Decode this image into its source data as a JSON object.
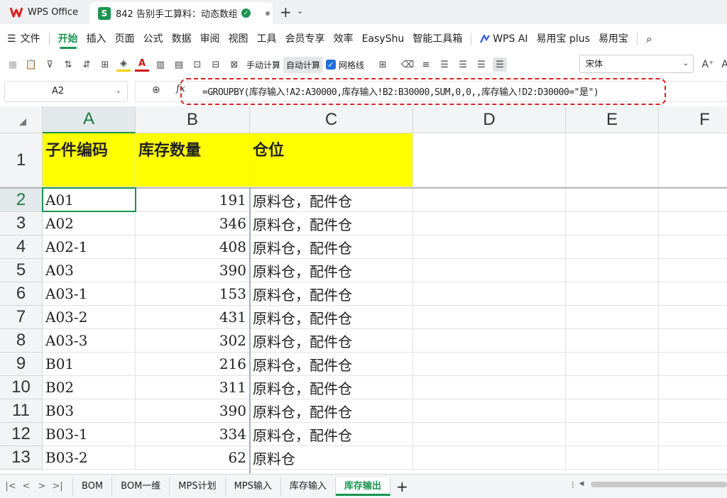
{
  "titlebar": {
    "app_name": "WPS Office",
    "doc_tab_title": "842 告别手工算料：动态数组"
  },
  "menu": {
    "items": [
      "文件",
      "开始",
      "插入",
      "页面",
      "公式",
      "数据",
      "审阅",
      "视图",
      "工具",
      "会员专享",
      "效率",
      "EasyShu",
      "智能工具箱",
      "WPS AI",
      "易用宝 plus",
      "易用宝"
    ],
    "active": "开始"
  },
  "toolbar": {
    "manual_calc": "手动计算",
    "auto_calc": "自动计算",
    "gridlines": "网格线",
    "font_name": "宋体"
  },
  "formula_bar": {
    "name_box": "A2",
    "formula": "=GROUPBY(库存输入!A2:A30000,库存输入!B2:B30000,SUM,0,0,,库存输入!D2:D30000=\"是\")"
  },
  "columns": [
    "A",
    "B",
    "C",
    "D",
    "E",
    "F"
  ],
  "header_row": {
    "row": "1",
    "a": "子件编码",
    "b": "库存数量",
    "c": "仓位"
  },
  "rows": [
    {
      "row": "2",
      "code": "A01",
      "qty": "191",
      "loc": "原料仓，配件仓"
    },
    {
      "row": "3",
      "code": "A02",
      "qty": "346",
      "loc": "原料仓，配件仓"
    },
    {
      "row": "4",
      "code": "A02-1",
      "qty": "408",
      "loc": "原料仓，配件仓"
    },
    {
      "row": "5",
      "code": "A03",
      "qty": "390",
      "loc": "原料仓，配件仓"
    },
    {
      "row": "6",
      "code": "A03-1",
      "qty": "153",
      "loc": "原料仓，配件仓"
    },
    {
      "row": "7",
      "code": "A03-2",
      "qty": "431",
      "loc": "原料仓，配件仓"
    },
    {
      "row": "8",
      "code": "A03-3",
      "qty": "302",
      "loc": "原料仓，配件仓"
    },
    {
      "row": "9",
      "code": "B01",
      "qty": "216",
      "loc": "原料仓，配件仓"
    },
    {
      "row": "10",
      "code": "B02",
      "qty": "311",
      "loc": "原料仓，配件仓"
    },
    {
      "row": "11",
      "code": "B03",
      "qty": "390",
      "loc": "原料仓，配件仓"
    },
    {
      "row": "12",
      "code": "B03-1",
      "qty": "334",
      "loc": "原料仓，配件仓"
    },
    {
      "row": "13",
      "code": "B03-2",
      "qty": "62",
      "loc": "原料仓"
    }
  ],
  "sheets": [
    "BOM",
    "BOM一维",
    "MPS计划",
    "MPS输入",
    "库存输入",
    "库存输出"
  ],
  "active_sheet": "库存输出"
}
